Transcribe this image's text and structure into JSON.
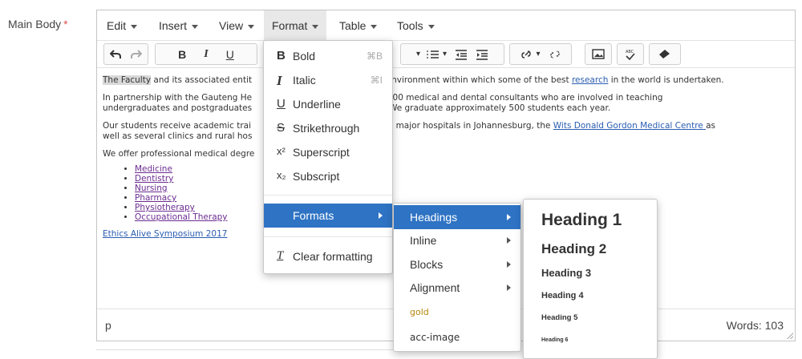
{
  "field": {
    "label": "Main Body",
    "required_mark": "*"
  },
  "menubar": {
    "items": [
      "Edit",
      "Insert",
      "View",
      "Format",
      "Table",
      "Tools"
    ]
  },
  "content": {
    "p1_highlight": "The Faculty",
    "p1_a": " and its associated entit",
    "p1_b": "brant environment within which some of the best ",
    "p1_link": "research",
    "p1_c": " in the world is undertaken.",
    "p2_line1a": "In partnership with the Gauteng He",
    "p2_line1b": "over 800 medical and dental consultants who are involved in teaching",
    "p2_line2a": "undergraduates and postgraduates",
    "p2_line2b": "mes. We graduate approximately 500 students each year.",
    "p3_line1a": "Our students receive academic trai",
    "p3_line1b": "in five major hospitals in Johannesburg, the ",
    "p3_link": "Wits Donald Gordon Medical Centre ",
    "p3_line1c": "as",
    "p3_line2": "well as several clinics and rural hos",
    "p4": "We offer professional medical degre",
    "list": [
      "Medicine",
      "Dentistry",
      "Nursing",
      "Pharmacy",
      "Physiotherapy",
      "Occupational Therapy"
    ],
    "ethics_link": "Ethics Alive Symposium 2017"
  },
  "statusbar": {
    "path": "p",
    "word_count": "Words: 103"
  },
  "format_menu": {
    "bold": {
      "icon": "B",
      "label": "Bold",
      "shortcut": "⌘B"
    },
    "italic": {
      "icon": "I",
      "label": "Italic",
      "shortcut": "⌘I"
    },
    "underline": {
      "icon": "U",
      "label": "Underline"
    },
    "strikethrough": {
      "icon": "S",
      "label": "Strikethrough"
    },
    "superscript": {
      "icon": "x²",
      "label": "Superscript"
    },
    "subscript": {
      "icon": "x₂",
      "label": "Subscript"
    },
    "formats": {
      "label": "Formats"
    },
    "clear": {
      "icon": "T",
      "label": "Clear formatting"
    }
  },
  "formats_submenu": {
    "items": [
      "Headings",
      "Inline",
      "Blocks",
      "Alignment",
      "gold",
      "acc-image"
    ],
    "gold_color": "#b8860b",
    "selected_color": "#2e73c4"
  },
  "headings_submenu": {
    "items": [
      "Heading 1",
      "Heading 2",
      "Heading 3",
      "Heading 4",
      "Heading 5",
      "Heading 6"
    ]
  }
}
